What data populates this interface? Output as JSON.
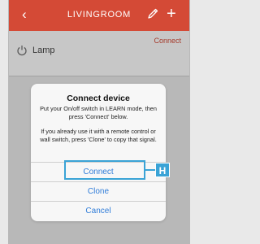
{
  "header": {
    "back_icon": "chevron-left-icon",
    "title": "LIVINGROOM",
    "edit_icon": "pencil-icon",
    "add_icon": "plus-icon"
  },
  "device": {
    "icon": "power-icon",
    "name": "Lamp",
    "connect_label": "Connect"
  },
  "dialog": {
    "title": "Connect device",
    "message_1": "Put your On/off switch in LEARN mode, then press 'Connect' below.",
    "message_2": "If you already use it with a remote control or wall switch, press 'Clone' to copy that signal.",
    "buttons": {
      "connect": "Connect",
      "clone": "Clone",
      "cancel": "Cancel"
    }
  },
  "annotation": {
    "label": "H",
    "color": "#3aa3d6"
  },
  "colors": {
    "accent": "#d44a36",
    "link": "#2f7cd8"
  }
}
